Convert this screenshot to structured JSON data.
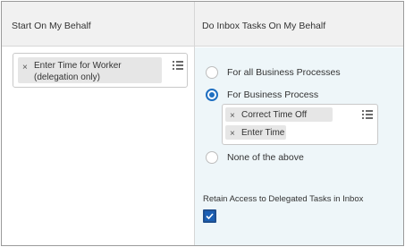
{
  "columns": {
    "left_header": "Start On My Behalf",
    "right_header": "Do Inbox Tasks On My Behalf"
  },
  "start_on_behalf": {
    "selected_items": [
      "Enter Time for Worker (delegation only)"
    ],
    "remove_icon": "×"
  },
  "inbox_tasks": {
    "options": [
      {
        "label": "For all Business Processes",
        "selected": false
      },
      {
        "label": "For Business Process",
        "selected": true
      },
      {
        "label": "None of the above",
        "selected": false
      }
    ],
    "selected_processes": [
      "Correct Time Off",
      "Enter Time"
    ],
    "remove_icon": "×",
    "retain_access_label": "Retain Access to Delegated Tasks in Inbox",
    "retain_access_checked": true
  },
  "colors": {
    "accent": "#1f6fc1",
    "header_bg": "#f1f1f1",
    "panel_bg": "#eef6f9",
    "pill_bg": "#e6e6e6"
  }
}
